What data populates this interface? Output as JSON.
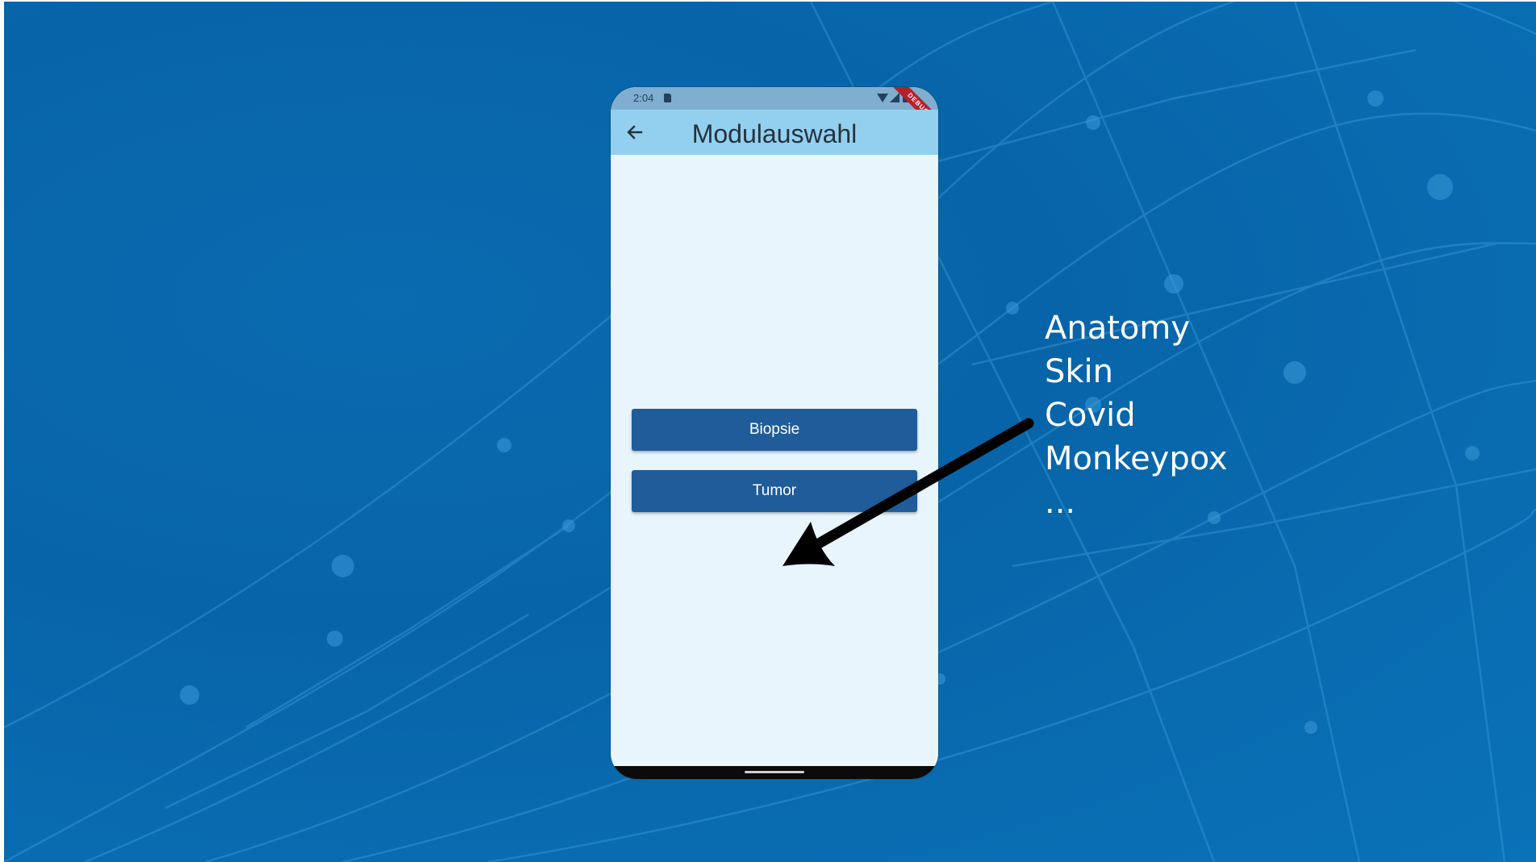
{
  "status_bar": {
    "time": "2:04",
    "icons": [
      "sd-card-icon",
      "wifi-icon",
      "signal-icon",
      "battery-icon"
    ]
  },
  "debug_banner": "DEBUG",
  "app_bar": {
    "back_icon": "arrow-left-icon",
    "title": "Modulauswahl"
  },
  "buttons": {
    "biopsie": "Biopsie",
    "tumor": "Tumor"
  },
  "annotation": {
    "items": [
      "Anatomy",
      "Skin",
      "Covid",
      "Monkeypox",
      "..."
    ]
  },
  "colors": {
    "background": "#0a6bb0",
    "app_bar": "#93d0f0",
    "screen": "#e9f5fd",
    "button": "#1f5c99",
    "debug_banner": "#b8202a"
  }
}
